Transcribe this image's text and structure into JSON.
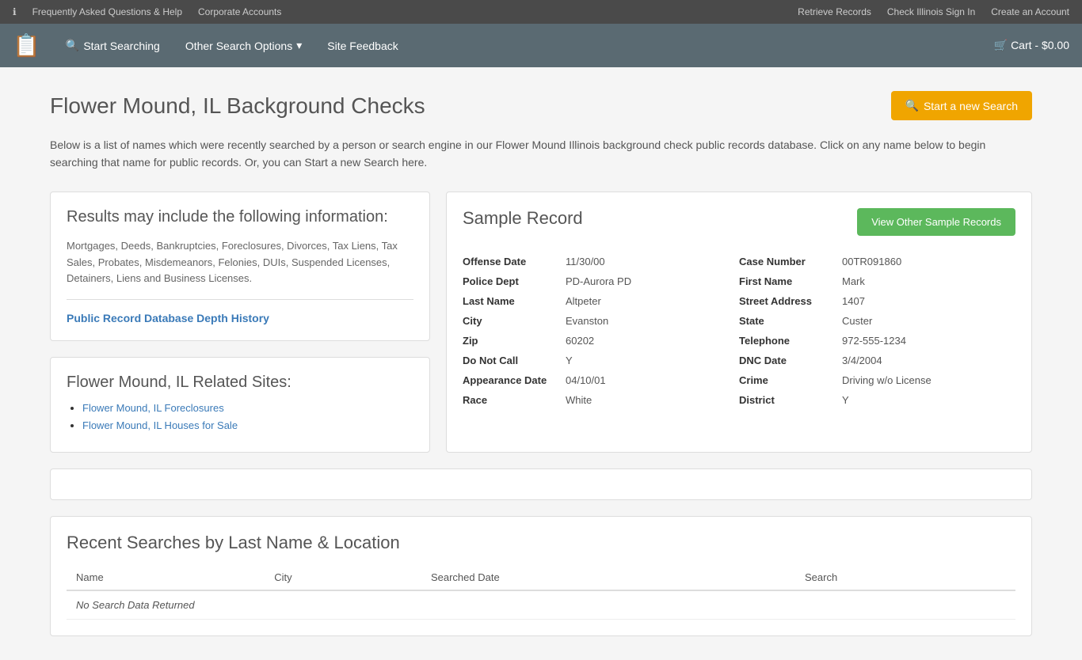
{
  "topbar": {
    "left": {
      "faq_label": "Frequently Asked Questions & Help",
      "corporate_label": "Corporate Accounts"
    },
    "right": {
      "retrieve_label": "Retrieve Records",
      "signin_label": "Check Illinois Sign In",
      "create_label": "Create an Account"
    }
  },
  "navbar": {
    "logo_icon": "📋",
    "start_searching_label": "Start Searching",
    "other_search_label": "Other Search Options",
    "site_feedback_label": "Site Feedback",
    "cart_label": "Cart - $0.00"
  },
  "main": {
    "page_title": "Flower Mound, IL Background Checks",
    "start_new_search_btn": "Start a new Search",
    "description": "Below is a list of names which were recently searched by a person or search engine in our Flower Mound Illinois background check public records database. Click on any name below to begin searching that name for public records. Or, you can Start a new Search here.",
    "results_section": {
      "title": "Results may include the following information:",
      "text": "Mortgages, Deeds, Bankruptcies, Foreclosures, Divorces, Tax Liens, Tax Sales, Probates, Misdemeanors, Felonies, DUIs, Suspended Licenses, Detainers, Liens and Business Licenses.",
      "link_label": "Public Record Database Depth History"
    },
    "related_sites": {
      "title": "Flower Mound, IL Related Sites:",
      "items": [
        {
          "label": "Flower Mound, IL Foreclosures"
        },
        {
          "label": "Flower Mound, IL Houses for Sale"
        }
      ]
    },
    "sample_record": {
      "title": "Sample Record",
      "view_other_btn": "View Other Sample Records",
      "fields_left": [
        {
          "label": "Offense Date",
          "value": "11/30/00"
        },
        {
          "label": "Police Dept",
          "value": "PD-Aurora PD"
        },
        {
          "label": "Last Name",
          "value": "Altpeter"
        },
        {
          "label": "City",
          "value": "Evanston"
        },
        {
          "label": "Zip",
          "value": "60202"
        },
        {
          "label": "Do Not Call",
          "value": "Y"
        },
        {
          "label": "Appearance Date",
          "value": "04/10/01"
        },
        {
          "label": "Race",
          "value": "White"
        }
      ],
      "fields_right": [
        {
          "label": "Case Number",
          "value": "00TR091860"
        },
        {
          "label": "First Name",
          "value": "Mark"
        },
        {
          "label": "Street Address",
          "value": "1407"
        },
        {
          "label": "State",
          "value": "Custer"
        },
        {
          "label": "Telephone",
          "value": "972-555-1234"
        },
        {
          "label": "DNC Date",
          "value": "3/4/2004"
        },
        {
          "label": "Crime",
          "value": "Driving w/o License"
        },
        {
          "label": "District",
          "value": "Y"
        }
      ]
    },
    "recent_searches": {
      "title": "Recent Searches by Last Name & Location",
      "columns": [
        "Name",
        "City",
        "Searched Date",
        "Search"
      ],
      "no_data": "No Search Data Returned"
    }
  }
}
